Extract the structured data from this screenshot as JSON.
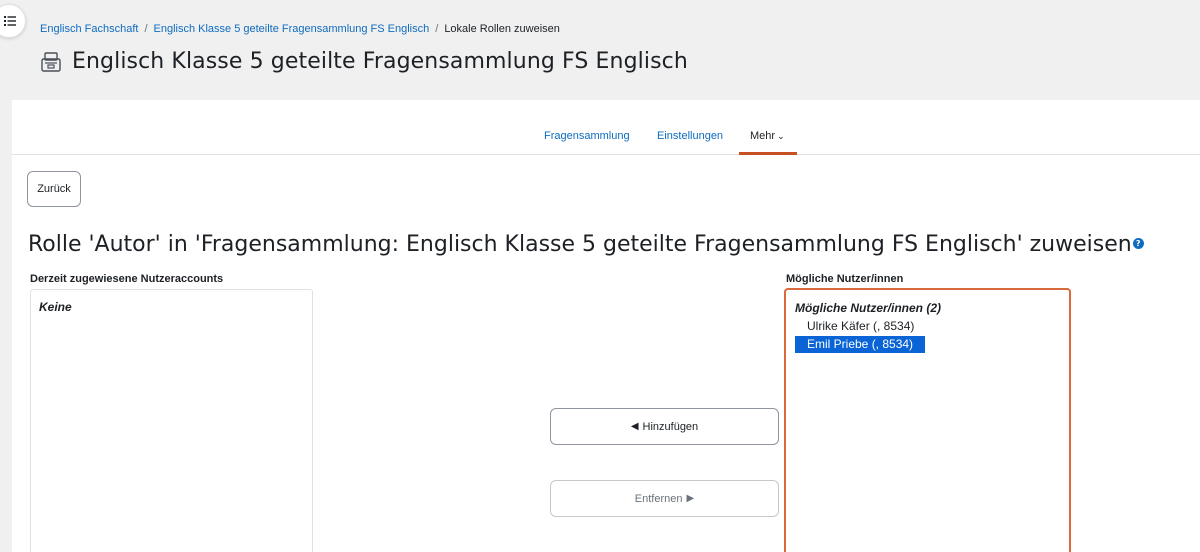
{
  "breadcrumb": {
    "items": [
      "Englisch Fachschaft",
      "Englisch Klasse 5 geteilte Fragensammlung FS Englisch"
    ],
    "current": "Lokale Rollen zuweisen",
    "separator": "/"
  },
  "page": {
    "title": "Englisch Klasse 5 geteilte Fragensammlung FS Englisch",
    "icon": "question-bank-icon"
  },
  "secondary_nav": {
    "tabs": [
      {
        "label": "Fragensammlung"
      },
      {
        "label": "Einstellungen"
      },
      {
        "label": "Mehr"
      }
    ],
    "more_chevron": "⌄",
    "active_tab": "Mehr"
  },
  "back_button": {
    "label": "Zurück"
  },
  "role_heading": "Rolle 'Autor' in 'Fragensammlung: Englisch Klasse 5 geteilte Fragensammlung FS Englisch' zuweisen",
  "current_users": {
    "label": "Derzeit zugewiesene Nutzeraccounts",
    "group": "Keine"
  },
  "potential_users": {
    "label": "Mögliche Nutzer/innen",
    "group": "Mögliche Nutzer/innen (2)",
    "options": [
      {
        "label": "Ulrike Käfer (, 8534)",
        "selected": false
      },
      {
        "label": "Emil Priebe (, 8534)",
        "selected": true
      }
    ]
  },
  "buttons": {
    "add": {
      "arrow": "◀",
      "label": "Hinzufügen",
      "enabled": true
    },
    "remove": {
      "arrow": "▶",
      "label": "Entfernen",
      "enabled": false
    }
  },
  "colors": {
    "link": "#0f6cbf",
    "accent": "#c74f21",
    "focus_border": "#d9693a",
    "selection": "#0a64d6"
  }
}
